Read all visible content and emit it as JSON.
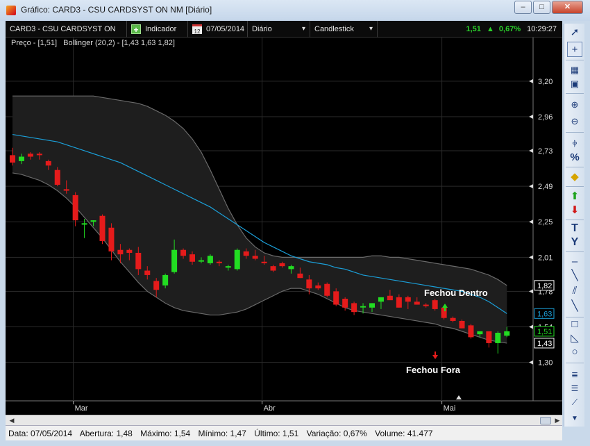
{
  "window": {
    "title": "Gráfico: CARD3 - CSU CARDSYST ON NM [Diário]",
    "minimize": "–",
    "maximize": "□",
    "close": "✕"
  },
  "toolbar": {
    "symbol": "CARD3 - CSU CARDSYST ON NM",
    "indicator_label": "Indicador",
    "indicator_icon": "+",
    "calendar_icon_day": "12",
    "date": "07/05/2014",
    "period": "Diário",
    "chart_type": "Candlestick",
    "price": "1,51",
    "arrow": "▲",
    "variation": "0,67%",
    "time": "10:29:27"
  },
  "legend": {
    "price": "Preço - [1,51]",
    "bollinger": "Bollinger (20,2) - [1,43 1,63 1,82]"
  },
  "annotations": {
    "closed_inside": "Fechou Dentro",
    "closed_outside": "Fechou Fora"
  },
  "colors": {
    "up": "#22dd22",
    "down": "#e51b1b",
    "middle_band": "#1b9fd8",
    "band_fill": "#1e1e1e",
    "band_edge": "#6a6a6a"
  },
  "chart_data": {
    "type": "candlestick",
    "y_ticks": [
      "3,20",
      "2,96",
      "2,73",
      "2,49",
      "2,25",
      "2,01",
      "1,78",
      "1,54",
      "1,30"
    ],
    "y_tick_values": [
      3.2,
      2.96,
      2.73,
      2.49,
      2.25,
      2.01,
      1.78,
      1.54,
      1.3
    ],
    "ylim": [
      1.04,
      3.42
    ],
    "x_labels": [
      "Mar",
      "Abr",
      "Mai"
    ],
    "x_label_index": [
      7,
      28,
      48
    ],
    "price_tags": [
      {
        "label": "1,82",
        "value": 1.82,
        "color": "#ffffff"
      },
      {
        "label": "1,63",
        "value": 1.63,
        "color": "#1b9fd8"
      },
      {
        "label": "1,51",
        "value": 1.51,
        "color": "#22dd22"
      },
      {
        "label": "1,43",
        "value": 1.43,
        "color": "#ffffff"
      }
    ],
    "candles": [
      [
        2.7,
        2.75,
        2.63,
        2.65
      ],
      [
        2.66,
        2.71,
        2.64,
        2.69
      ],
      [
        2.71,
        2.72,
        2.67,
        2.69
      ],
      [
        2.71,
        2.72,
        2.67,
        2.7
      ],
      [
        2.66,
        2.67,
        2.6,
        2.63
      ],
      [
        2.6,
        2.62,
        2.49,
        2.5
      ],
      [
        2.47,
        2.53,
        2.44,
        2.46
      ],
      [
        2.43,
        2.45,
        2.22,
        2.26
      ],
      [
        2.24,
        2.27,
        2.14,
        2.24
      ],
      [
        2.25,
        2.26,
        2.22,
        2.26
      ],
      [
        2.29,
        2.3,
        2.1,
        2.12
      ],
      [
        2.21,
        2.24,
        1.99,
        2.05
      ],
      [
        2.06,
        2.1,
        1.97,
        2.03
      ],
      [
        2.06,
        2.07,
        1.99,
        2.04
      ],
      [
        2.04,
        2.08,
        1.89,
        1.93
      ],
      [
        1.92,
        1.95,
        1.86,
        1.89
      ],
      [
        1.85,
        1.87,
        1.74,
        1.79
      ],
      [
        1.82,
        1.9,
        1.8,
        1.89
      ],
      [
        1.91,
        2.13,
        1.9,
        2.06
      ],
      [
        2.06,
        2.07,
        2.0,
        2.02
      ],
      [
        2.03,
        2.05,
        1.96,
        1.98
      ],
      [
        1.99,
        2.01,
        1.97,
        1.99
      ],
      [
        1.97,
        2.03,
        1.96,
        2.02
      ],
      [
        1.98,
        1.99,
        1.95,
        1.97
      ],
      [
        1.94,
        1.96,
        1.92,
        1.95
      ],
      [
        1.93,
        2.07,
        1.92,
        2.06
      ],
      [
        2.05,
        2.07,
        2.0,
        2.02
      ],
      [
        2.02,
        2.06,
        1.99,
        2.0
      ],
      [
        1.98,
        2.02,
        1.96,
        1.97
      ],
      [
        1.95,
        1.96,
        1.91,
        1.92
      ],
      [
        1.97,
        1.98,
        1.94,
        1.95
      ],
      [
        1.93,
        1.96,
        1.9,
        1.95
      ],
      [
        1.9,
        1.94,
        1.87,
        1.87
      ],
      [
        1.86,
        1.89,
        1.76,
        1.8
      ],
      [
        1.82,
        1.84,
        1.79,
        1.8
      ],
      [
        1.83,
        1.84,
        1.74,
        1.75
      ],
      [
        1.78,
        1.8,
        1.68,
        1.69
      ],
      [
        1.73,
        1.74,
        1.65,
        1.67
      ],
      [
        1.7,
        1.71,
        1.62,
        1.64
      ],
      [
        1.68,
        1.7,
        1.63,
        1.68
      ],
      [
        1.67,
        1.7,
        1.64,
        1.7
      ],
      [
        1.71,
        1.74,
        1.66,
        1.74
      ],
      [
        1.75,
        1.79,
        1.73,
        1.72
      ],
      [
        1.74,
        1.76,
        1.67,
        1.67
      ],
      [
        1.74,
        1.75,
        1.66,
        1.71
      ],
      [
        1.71,
        1.74,
        1.69,
        1.69
      ],
      [
        1.69,
        1.7,
        1.67,
        1.68
      ],
      [
        1.72,
        1.73,
        1.65,
        1.66
      ],
      [
        1.67,
        1.68,
        1.59,
        1.6
      ],
      [
        1.6,
        1.61,
        1.57,
        1.58
      ],
      [
        1.58,
        1.59,
        1.53,
        1.53
      ],
      [
        1.55,
        1.56,
        1.46,
        1.47
      ],
      [
        1.49,
        1.51,
        1.47,
        1.51
      ],
      [
        1.51,
        1.51,
        1.4,
        1.43
      ],
      [
        1.43,
        1.51,
        1.36,
        1.5
      ],
      [
        1.48,
        1.54,
        1.47,
        1.51
      ]
    ],
    "middle_band": [
      2.84,
      2.83,
      2.82,
      2.81,
      2.8,
      2.79,
      2.77,
      2.75,
      2.73,
      2.71,
      2.69,
      2.67,
      2.65,
      2.62,
      2.59,
      2.56,
      2.53,
      2.5,
      2.47,
      2.44,
      2.41,
      2.38,
      2.35,
      2.31,
      2.27,
      2.23,
      2.19,
      2.15,
      2.11,
      2.08,
      2.05,
      2.02,
      2.0,
      1.98,
      1.97,
      1.96,
      1.94,
      1.93,
      1.91,
      1.89,
      1.88,
      1.87,
      1.86,
      1.85,
      1.84,
      1.83,
      1.82,
      1.81,
      1.8,
      1.79,
      1.78,
      1.76,
      1.74,
      1.71,
      1.67,
      1.63
    ],
    "upper_band": [
      3.1,
      3.1,
      3.1,
      3.1,
      3.1,
      3.1,
      3.1,
      3.1,
      3.1,
      3.1,
      3.09,
      3.08,
      3.07,
      3.06,
      3.05,
      3.03,
      3.0,
      2.97,
      2.93,
      2.88,
      2.81,
      2.72,
      2.6,
      2.47,
      2.34,
      2.23,
      2.14,
      2.08,
      2.04,
      2.02,
      2.01,
      2.01,
      2.01,
      2.01,
      2.01,
      2.01,
      2.01,
      2.01,
      2.01,
      2.01,
      2.02,
      2.02,
      2.01,
      2.01,
      2.0,
      1.99,
      1.98,
      1.97,
      1.96,
      1.95,
      1.94,
      1.93,
      1.91,
      1.89,
      1.86,
      1.82
    ],
    "lower_band": [
      2.58,
      2.57,
      2.55,
      2.53,
      2.5,
      2.46,
      2.41,
      2.35,
      2.28,
      2.21,
      2.14,
      2.06,
      1.98,
      1.91,
      1.84,
      1.78,
      1.74,
      1.7,
      1.67,
      1.65,
      1.64,
      1.63,
      1.62,
      1.62,
      1.63,
      1.64,
      1.66,
      1.69,
      1.72,
      1.75,
      1.78,
      1.8,
      1.8,
      1.78,
      1.76,
      1.73,
      1.7,
      1.67,
      1.65,
      1.64,
      1.63,
      1.62,
      1.61,
      1.6,
      1.59,
      1.58,
      1.57,
      1.56,
      1.54,
      1.53,
      1.51,
      1.49,
      1.47,
      1.45,
      1.44,
      1.43
    ]
  },
  "status": {
    "date": "Data: 07/05/2014",
    "open": "Abertura: 1,48",
    "high": "Máximo: 1,54",
    "low": "Mínimo: 1,47",
    "last": "Último: 1,51",
    "variation": "Variação: 0,67%",
    "volume": "Volume: 41.477"
  },
  "side_tools": {
    "items": [
      "arrow-icon",
      "crosshair-icon",
      "table-icon",
      "save-icon",
      "zoom-in-icon",
      "zoom-out-icon",
      "fibonacci-icon",
      "percent-icon",
      "eraser-icon",
      "buy-arrow-icon",
      "sell-arrow-icon",
      "text-icon",
      "y-text-icon",
      "horizontal-line-icon",
      "diagonal-line-icon",
      "parallel-lines-icon",
      "channel-icon",
      "rectangle-icon",
      "triangle-icon",
      "ellipse-icon",
      "align-icon",
      "lines-icon",
      "fan-icon"
    ],
    "glyphs": {
      "text": "T",
      "y_text": "Y",
      "percent": "%"
    }
  }
}
